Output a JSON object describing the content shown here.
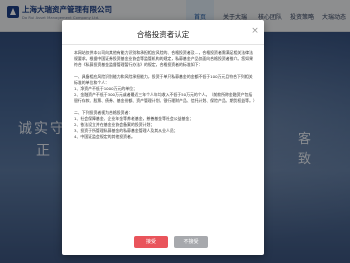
{
  "site": {
    "logo_name": "上海大瑞资产管理有限公司",
    "logo_en": "Da Rui Asset Management Company Ltd.",
    "nav": [
      "首页",
      "关于大瑞",
      "核心团队",
      "投资策略",
      "大瑞动态"
    ],
    "hero_left_line1": "诚实守",
    "hero_left_line2": "正",
    "hero_right_line1": "客",
    "hero_right_line2": "致"
  },
  "modal": {
    "title": "合格投资者认定",
    "close_label": "×",
    "intro": "本网站仅供本公司向其他有能力识别和承担相应风险的、合格投资者及…，合格投资者需满足相关法律法规要求。根据中国证券投资基金业协会等监管机构的规定，私募基金产品仅面向合格投资者推介。您如果符合《私募投资基金监督管理暂行办法》的规定，合格投资者的标准如下：",
    "section1_title": "一、具备相应风险识别能力和风险承担能力，投资于单只私募基金的金额不低于100万元且符合下列相关标准的单位和个人：",
    "section1_items": [
      "1、净资产不低于1000万元的单位；",
      "2、金融资产不低于300万元或者最近三年个人年均收入不低于50万元的个人。（前款所称金融资产包括银行存款、股票、债券、基金份额、资产管理计划、银行理财产品、信托计划、保险产品、期货权益等。）"
    ],
    "section2_title": "二、下列投资者视为合格投资者：",
    "section2_items": [
      "1、社会保障基金、企业年金等养老基金，慈善基金等社会公益基金；",
      "2、依法设立并在基金业协会备案的投资计划；",
      "3、投资于所管理私募基金的私募基金管理人及其从业人员；",
      "4、中国证监会规定的其他投资者。"
    ],
    "accept_label": "接受",
    "decline_label": "不接受"
  },
  "colors": {
    "accept": "#e9545b",
    "decline": "#a7a9ad",
    "brand": "#1d3f86"
  }
}
